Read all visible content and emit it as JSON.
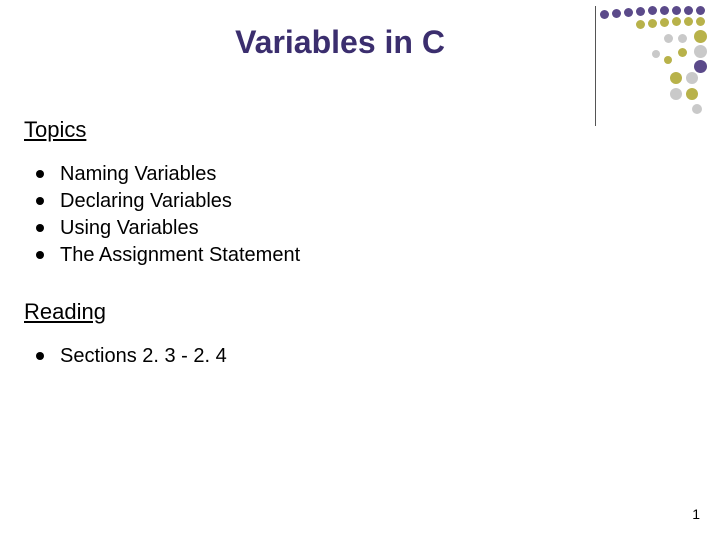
{
  "title": "Variables in C",
  "sections": {
    "topics": {
      "heading": "Topics",
      "items": [
        "Naming Variables",
        "Declaring Variables",
        "Using Variables",
        "The Assignment Statement"
      ]
    },
    "reading": {
      "heading": "Reading",
      "items": [
        "Sections 2. 3 - 2. 4"
      ]
    }
  },
  "page_number": "1",
  "decoration": {
    "colors": {
      "purple": "#5b4a8a",
      "olive": "#b8b24a",
      "gray": "#c9c9c9"
    }
  }
}
